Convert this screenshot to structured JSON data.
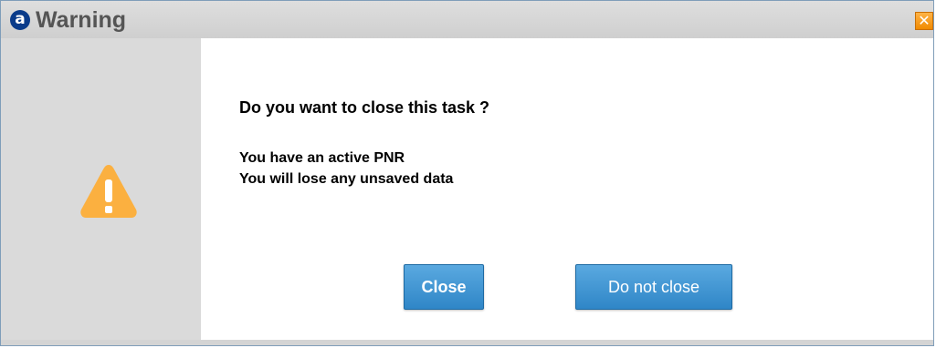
{
  "dialog": {
    "title": "Warning",
    "logo_glyph": "a",
    "close_glyph": "✕",
    "question": "Do you want to close this task ?",
    "messages": [
      "You have an active PNR",
      "You will lose any unsaved data"
    ],
    "buttons": {
      "close_label": "Close",
      "do_not_close_label": "Do not close"
    },
    "icons": {
      "app": "amadeus-logo-icon",
      "close": "close-icon",
      "warning": "warning-triangle-icon"
    },
    "colors": {
      "warning": "#fbb040",
      "button": "#2f86c7",
      "close_button": "#f08a00"
    }
  }
}
